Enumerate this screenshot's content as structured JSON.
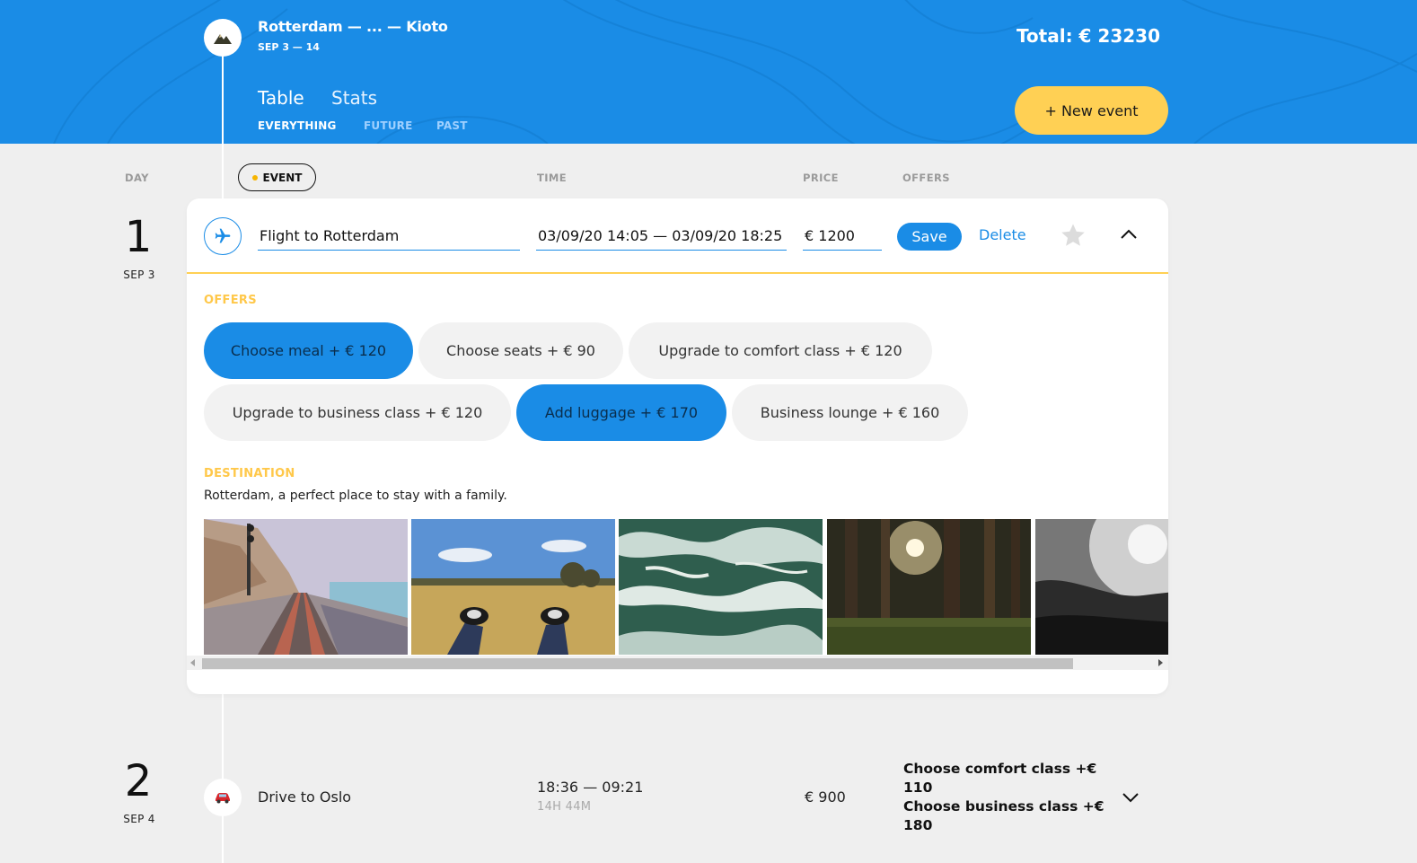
{
  "header": {
    "trip_title": "Rotterdam — ... — Kioto",
    "trip_dates": "SEP 3 — 14",
    "total": "Total: € 23230",
    "tabs": [
      {
        "label": "Table"
      },
      {
        "label": "Stats"
      }
    ],
    "filters": [
      {
        "label": "EVERYTHING"
      },
      {
        "label": "FUTURE"
      },
      {
        "label": "PAST"
      }
    ],
    "new_event_label": "+ New event"
  },
  "columns": {
    "day": "DAY",
    "event": "EVENT",
    "time": "TIME",
    "price": "PRICE",
    "offers": "OFFERS"
  },
  "days": [
    {
      "number": "1",
      "date": "SEP 3"
    },
    {
      "number": "2",
      "date": "SEP 4"
    }
  ],
  "edit_event": {
    "icon": "airplane-icon",
    "title_value": "Flight to Rotterdam",
    "time_value": "03/09/20 14:05 — 03/09/20 18:25",
    "price_value": "€ 1200",
    "save_label": "Save",
    "delete_label": "Delete",
    "offers_label": "OFFERS",
    "offers": [
      {
        "label": "Choose meal + € 120",
        "selected": true
      },
      {
        "label": "Choose seats + € 90",
        "selected": false
      },
      {
        "label": "Upgrade to comfort class + € 120",
        "selected": false
      },
      {
        "label": "Upgrade to business class + € 120",
        "selected": false
      },
      {
        "label": "Add luggage + € 170",
        "selected": true
      },
      {
        "label": "Business lounge + € 160",
        "selected": false
      }
    ],
    "destination_label": "DESTINATION",
    "destination_text": "Rotterdam, a perfect place to stay with a family."
  },
  "events": [
    {
      "icon": "car-icon",
      "title": "Drive to Oslo",
      "time": "18:36 — 09:21",
      "duration": "14H 44M",
      "price": "€ 900",
      "offers": [
        "Choose comfort class +€ 110",
        "Choose business class +€ 180"
      ]
    }
  ],
  "colors": {
    "brand_blue": "#1a8ce6",
    "accent_yellow": "#ffd054",
    "background": "#efefef"
  }
}
